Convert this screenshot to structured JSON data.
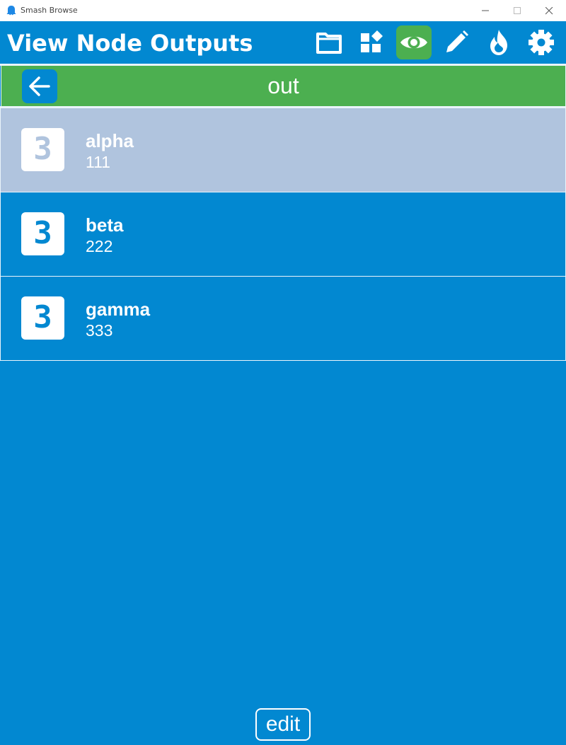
{
  "window": {
    "title": "Smash Browse"
  },
  "header": {
    "title": "View Node Outputs",
    "tools": [
      {
        "name": "folder-icon",
        "active": false
      },
      {
        "name": "widgets-icon",
        "active": false
      },
      {
        "name": "eye-icon",
        "active": true
      },
      {
        "name": "pencil-icon",
        "active": false
      },
      {
        "name": "flame-icon",
        "active": false
      },
      {
        "name": "gear-icon",
        "active": false
      }
    ]
  },
  "breadcrumb": {
    "title": "out",
    "back_icon": "arrow-left-icon"
  },
  "outputs": [
    {
      "badge": "3",
      "name": "alpha",
      "value": "111",
      "selected": true
    },
    {
      "badge": "3",
      "name": "beta",
      "value": "222",
      "selected": false
    },
    {
      "badge": "3",
      "name": "gamma",
      "value": "333",
      "selected": false
    }
  ],
  "footer": {
    "edit_label": "edit"
  },
  "colors": {
    "primary": "#0288d1",
    "active": "#4caf50",
    "selected_row": "#b0c4de",
    "text": "#ffffff"
  }
}
